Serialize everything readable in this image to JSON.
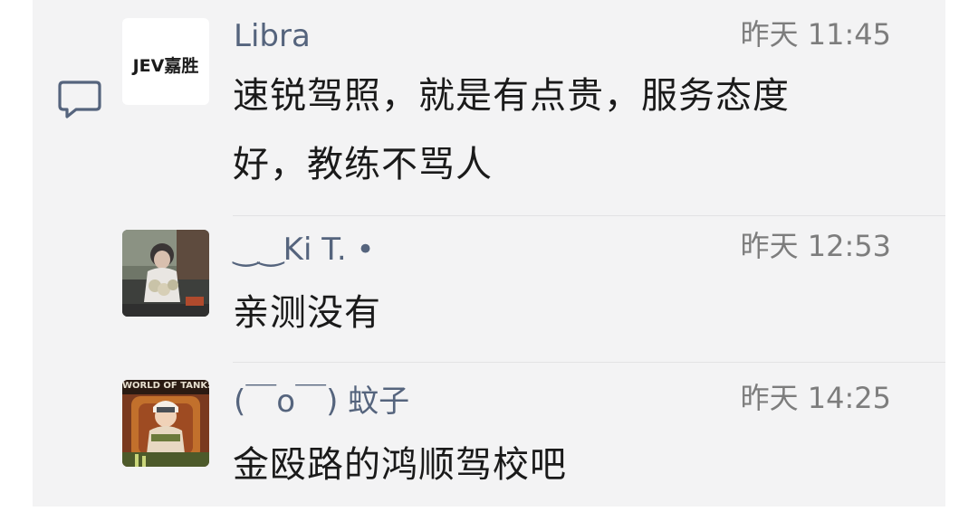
{
  "comments": [
    {
      "author": "Libra",
      "time": "昨天 11:45",
      "text": "速锐驾照，就是有点贵，服务态度好，教练不骂人",
      "avatar_logo": "JEV嘉胜",
      "avatar_icon": "brand-logo"
    },
    {
      "author": "‿‿Ki T. •",
      "time": "昨天 12:53",
      "text": "亲测没有",
      "avatar_icon": "user-photo"
    },
    {
      "author": "(￣o￣) 蚊子",
      "time": "昨天 14:25",
      "text": "金殴路的鸿顺驾校吧",
      "avatar_banner": "WORLD OF TANKS",
      "avatar_icon": "game-character"
    }
  ],
  "colors": {
    "panel_bg": "#f3f3f4",
    "author": "#55647d",
    "time": "#7d7d7d",
    "text": "#1a1a1a",
    "icon": "#55647d"
  },
  "reply_icon": "comment-bubble-icon"
}
